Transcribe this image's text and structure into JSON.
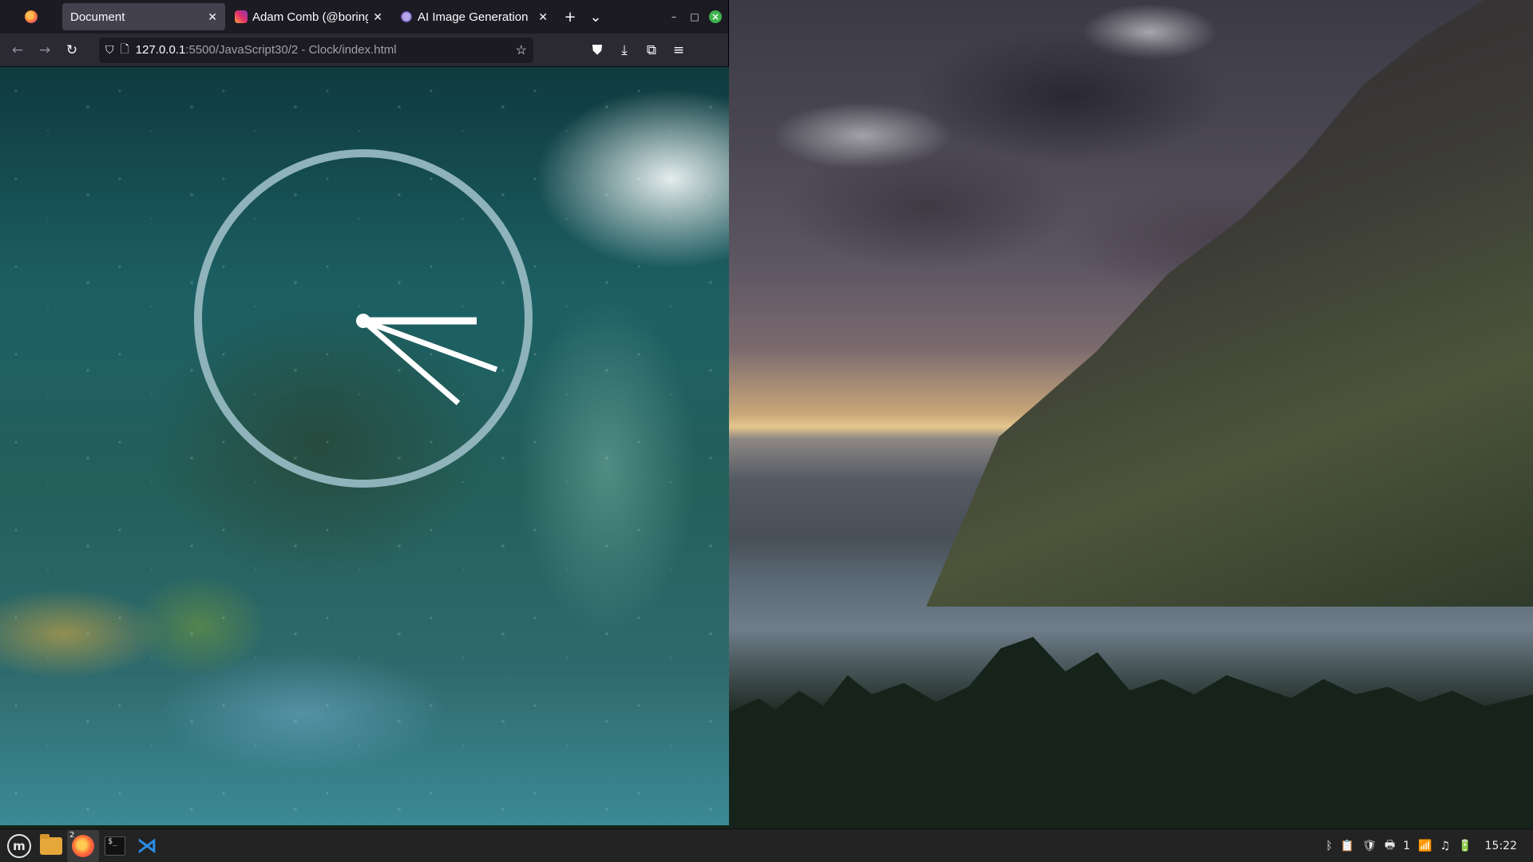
{
  "browser": {
    "tabs": [
      {
        "label": "Document",
        "active": true
      },
      {
        "label": "Adam Comb (@boring",
        "active": false,
        "icon": "instagram-icon"
      },
      {
        "label": "AI Image Generation",
        "active": false,
        "icon": "ai-icon"
      }
    ],
    "new_tab": "+",
    "tab_list": "⌄",
    "url": {
      "host": "127.0.0.1",
      "path": ":5500/JavaScript30/2 - Clock/index.html"
    }
  },
  "clock": {
    "ring_color": "#8fb3ba",
    "hand_color": "#ffffff",
    "hour_hand_angle_deg": 38,
    "minute_hand_angle_deg": 0,
    "second_hand_angle_deg": 20
  },
  "taskbar": {
    "firefox_window_count": "2",
    "tray": {
      "workspace": "1",
      "time": "15:22"
    }
  }
}
